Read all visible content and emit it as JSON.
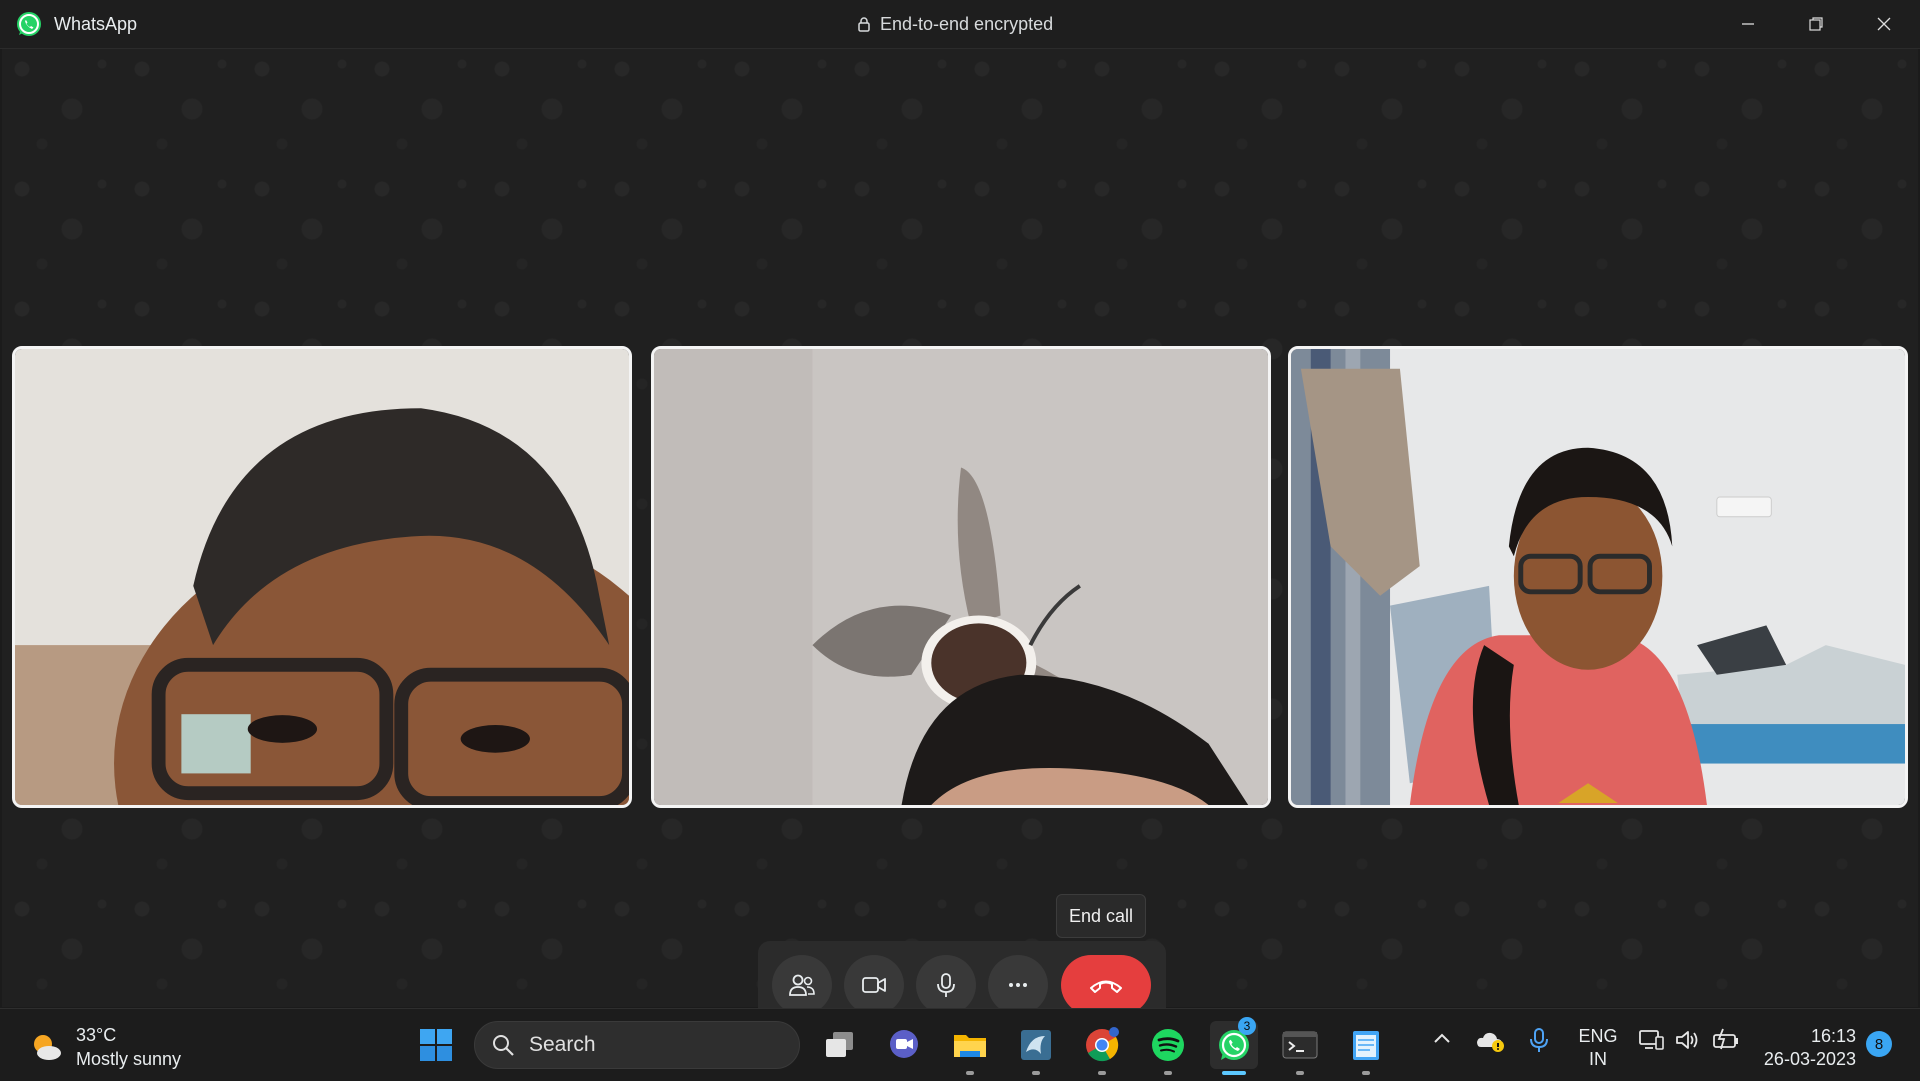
{
  "titlebar": {
    "app_name": "WhatsApp",
    "encryption": "End-to-end encrypted",
    "controls": [
      "minimize-icon",
      "restore-icon",
      "close-icon"
    ]
  },
  "call": {
    "participants": [
      {
        "id": "participant-1",
        "video": "on"
      },
      {
        "id": "participant-2",
        "video": "on"
      },
      {
        "id": "participant-3",
        "video": "on"
      }
    ],
    "controls": [
      {
        "name": "participants",
        "icon": "people-icon"
      },
      {
        "name": "camera",
        "icon": "video-camera-icon"
      },
      {
        "name": "microphone",
        "icon": "microphone-icon"
      },
      {
        "name": "more",
        "icon": "more-options-icon"
      },
      {
        "name": "end-call",
        "icon": "phone-hangup-icon"
      }
    ],
    "end_call_tooltip": "End call",
    "colors": {
      "end_call": "#e53e3e",
      "control_bg": "#393939"
    }
  },
  "taskbar": {
    "weather": {
      "temp": "33°C",
      "condition": "Mostly sunny"
    },
    "search_label": "Search",
    "apps": [
      {
        "name": "start",
        "icon": "windows-start-icon"
      },
      {
        "name": "task-view",
        "icon": "task-view-icon"
      },
      {
        "name": "teams-chat",
        "icon": "chat-icon"
      },
      {
        "name": "file-explorer",
        "icon": "folder-icon"
      },
      {
        "name": "mysql-workbench",
        "icon": "dolphin-icon"
      },
      {
        "name": "chrome",
        "icon": "chrome-icon"
      },
      {
        "name": "spotify",
        "icon": "spotify-icon"
      },
      {
        "name": "whatsapp",
        "icon": "whatsapp-icon",
        "badge": "3"
      },
      {
        "name": "terminal",
        "icon": "terminal-icon"
      },
      {
        "name": "notepad",
        "icon": "notepad-icon"
      }
    ],
    "language": {
      "line1": "ENG",
      "line2": "IN"
    },
    "time": "16:13",
    "date": "26-03-2023",
    "notification_count": "8"
  }
}
